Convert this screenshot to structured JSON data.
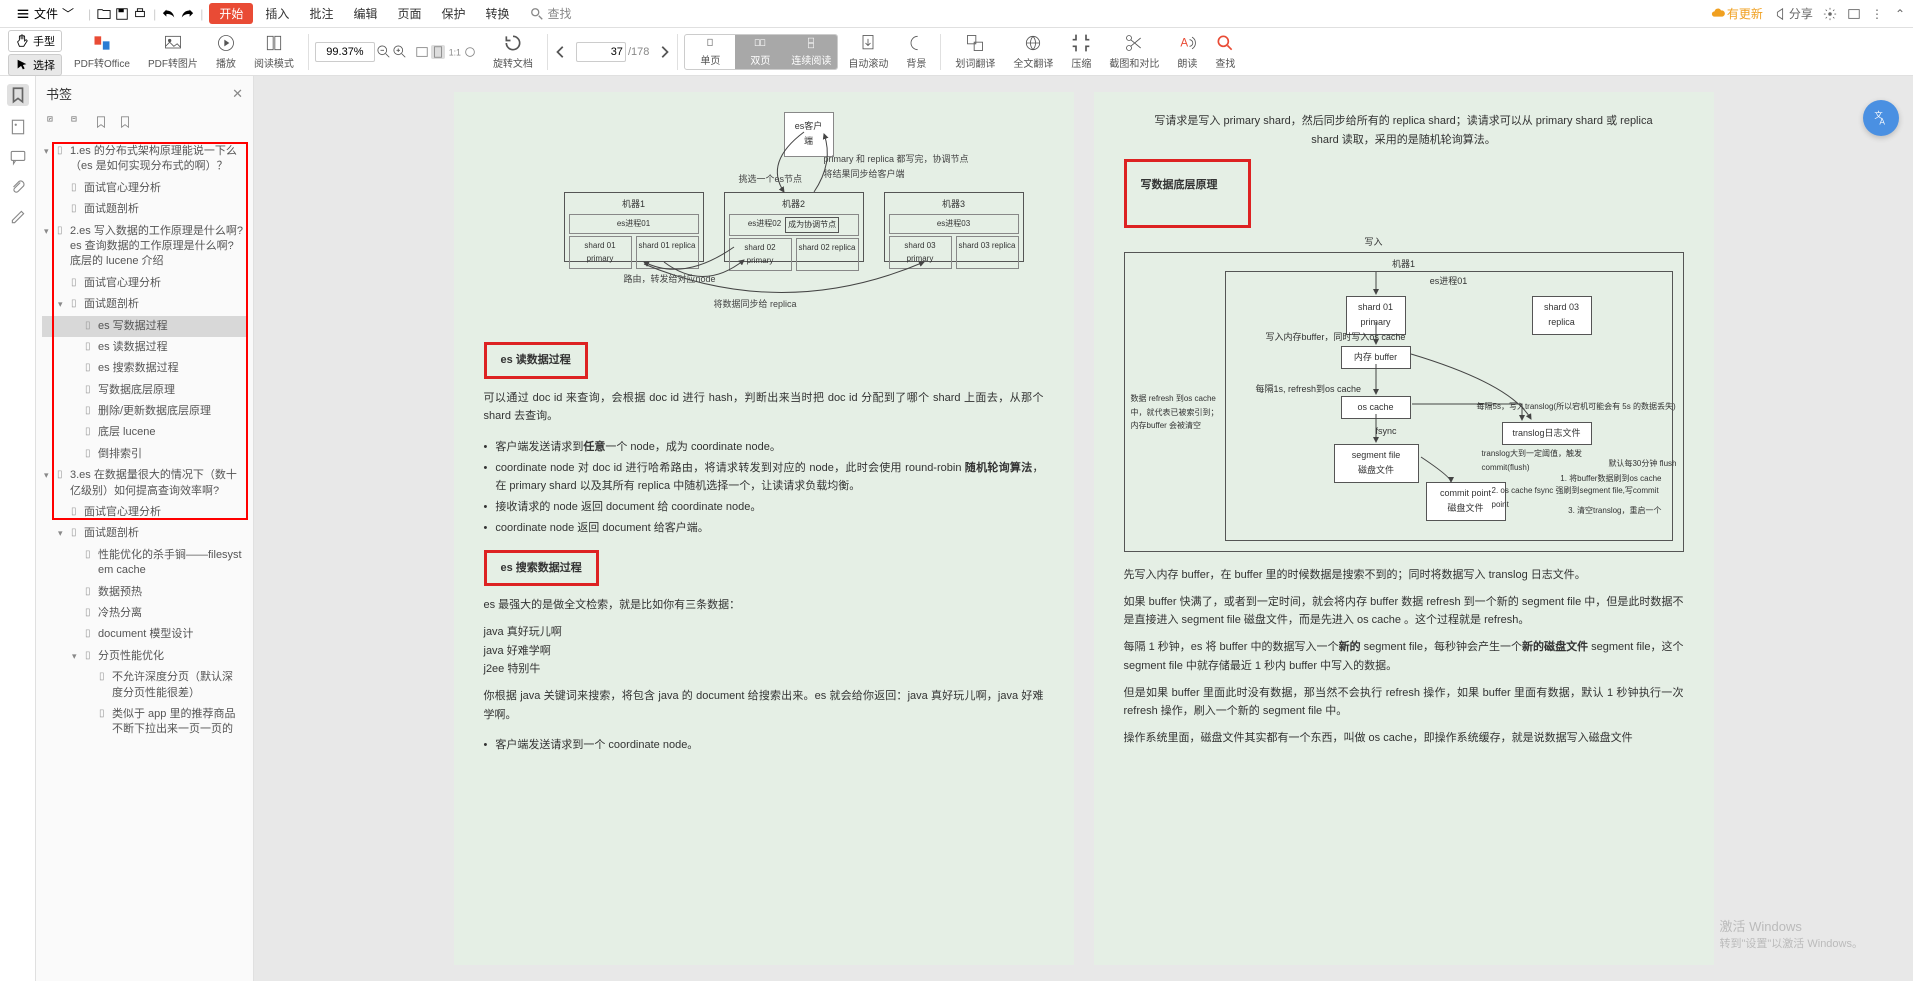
{
  "menubar": {
    "file": "文件",
    "start": "开始",
    "items": [
      "插入",
      "批注",
      "编辑",
      "页面",
      "保护",
      "转换"
    ],
    "search": "查找",
    "update": "有更新",
    "share": "分享"
  },
  "hs": {
    "hand": "手型",
    "select": "选择"
  },
  "ribbon": {
    "pdf2office": "PDF转Office",
    "pdf2img": "PDF转图片",
    "play": "播放",
    "readmode": "阅读模式",
    "zoom": "99.37%",
    "rotate": "旋转文档",
    "page_current": "37",
    "page_total": "/178",
    "single": "单页",
    "double": "双页",
    "continuous": "连续阅读",
    "autoscroll": "自动滚动",
    "bg": "背景",
    "word_trans": "划词翻译",
    "full_trans": "全文翻译",
    "compress": "压缩",
    "crop": "截图和对比",
    "read_aloud": "朗读",
    "find": "查找"
  },
  "bookmarks": {
    "title": "书签",
    "items": [
      {
        "l": 0,
        "arrow": "▾",
        "t": "1.es 的分布式架构原理能说一下么（es 是如何实现分布式的啊）？"
      },
      {
        "l": 1,
        "arrow": "",
        "t": "面试官心理分析"
      },
      {
        "l": 1,
        "arrow": "",
        "t": "面试题剖析"
      },
      {
        "l": 0,
        "arrow": "▾",
        "t": "2.es 写入数据的工作原理是什么啊?es 查询数据的工作原理是什么啊? 底层的 lucene 介绍"
      },
      {
        "l": 1,
        "arrow": "",
        "t": "面试官心理分析"
      },
      {
        "l": 1,
        "arrow": "▾",
        "t": "面试题剖析"
      },
      {
        "l": 2,
        "arrow": "",
        "t": "es 写数据过程",
        "sel": true
      },
      {
        "l": 2,
        "arrow": "",
        "t": "es 读数据过程"
      },
      {
        "l": 2,
        "arrow": "",
        "t": "es 搜索数据过程"
      },
      {
        "l": 2,
        "arrow": "",
        "t": "写数据底层原理"
      },
      {
        "l": 2,
        "arrow": "",
        "t": "删除/更新数据底层原理"
      },
      {
        "l": 2,
        "arrow": "",
        "t": "底层 lucene"
      },
      {
        "l": 2,
        "arrow": "",
        "t": "倒排索引"
      },
      {
        "l": 0,
        "arrow": "▾",
        "t": "3.es 在数据量很大的情况下（数十亿级别）如何提高查询效率啊?"
      },
      {
        "l": 1,
        "arrow": "",
        "t": "面试官心理分析"
      },
      {
        "l": 1,
        "arrow": "▾",
        "t": "面试题剖析"
      },
      {
        "l": 2,
        "arrow": "",
        "t": "性能优化的杀手锏——filesystem cache"
      },
      {
        "l": 2,
        "arrow": "",
        "t": "数据预热"
      },
      {
        "l": 2,
        "arrow": "",
        "t": "冷热分离"
      },
      {
        "l": 2,
        "arrow": "",
        "t": "document 模型设计"
      },
      {
        "l": 2,
        "arrow": "▾",
        "t": "分页性能优化"
      },
      {
        "l": 3,
        "arrow": "",
        "t": "不允许深度分页（默认深度分页性能很差）"
      },
      {
        "l": 3,
        "arrow": "",
        "t": "类似于 app 里的推荐商品不断下拉出来一页一页的"
      }
    ]
  },
  "pageL": {
    "d1": {
      "client": "es客户端",
      "note1": "primary 和 replica 都写完，协调节点将结果同步给客户端",
      "pick": "挑选一个es节点",
      "m1": "机器1",
      "m2": "机器2",
      "m3": "机器3",
      "p1": "es进程01",
      "p2": "es进程02",
      "p3": "es进程03",
      "coord": "成为协调节点",
      "s1p": "shard 01 primary",
      "s1r": "shard 01 replica",
      "s2p": "shard 02 primary",
      "s2r": "shard 02 replica",
      "s3p": "shard 03 primary",
      "s3r": "shard 03 replica",
      "route": "路由，转发给对应node",
      "sync": "将数据同步给 replica"
    },
    "h_read": "es 读数据过程",
    "p_read": "可以通过 doc id 来查询，会根据 doc id 进行 hash，判断出来当时把 doc id 分配到了哪个 shard 上面去，从那个 shard 去查询。",
    "b1a": "客户端发送请求到",
    "b1b": "任意",
    "b1c": "一个 node，成为 coordinate node。",
    "b2a": "coordinate node 对 doc id 进行哈希路由，将请求转发到对应的 node，此时会使用 round-robin",
    "b2b": "随机轮询算法",
    "b2c": "，在 primary shard 以及其所有 replica 中随机选择一个，让读请求负载均衡。",
    "b3": "接收请求的 node 返回 document 给 coordinate node。",
    "b4": "coordinate node 返回 document 给客户端。",
    "h_search": "es 搜索数据过程",
    "p_search_intro": "es 最强大的是做全文检索，就是比如你有三条数据：",
    "ex1": "java 真好玩儿啊",
    "ex2": "java 好难学啊",
    "ex3": "j2ee 特别牛",
    "p_search_res": "你根据 java 关键词来搜索，将包含 java 的 document 给搜索出来。es 就会给你返回：java 真好玩儿啊，java 好难学啊。",
    "p_search_bul": "客户端发送请求到一个 coordinate node。"
  },
  "pageR": {
    "p_top": "写请求是写入 primary shard，然后同步给所有的 replica shard；读请求可以从 primary shard 或 replica shard 读取，采用的是随机轮询算法。",
    "h_write": "写数据底层原理",
    "d2": {
      "write": "写入",
      "m": "机器1",
      "proc": "es进程01",
      "s1p": "shard 01 primary",
      "s3r": "shard 03 replica",
      "buf_note": "写入内存buffer，同时写入os cache",
      "buf": "内存 buffer",
      "refresh_l": "每隔1s, refresh到os cache",
      "refresh_note": "数据 refresh 到os cache 中，就代表已被索引到；\n内存buffer 会被清空",
      "oscache": "os cache",
      "trans_note": "每隔5s，写入translog(所以宕机可能会有 5s 的数据丢失)",
      "fsync": "fsync",
      "seg": "segment file\n磁盘文件",
      "translog": "translog日志文件",
      "commit": "commit point\n磁盘文件",
      "flush_head": "translog大到一定阈值，触发commit(flush)",
      "flush_def": "默认每30分钟 flush",
      "flush1": "1. 将buffer数据刷到os cache",
      "flush2": "2. os cache fsync 强刷到segment file,写commit point",
      "flush3": "3. 清空translog，重启一个"
    },
    "p1": "先写入内存 buffer，在 buffer 里的时候数据是搜索不到的；同时将数据写入 translog 日志文件。",
    "p2a": "如果 buffer 快满了，或者到一定时间，就会将内存 buffer 数据 refresh 到一个新的 segment file 中，但是此时数据不是直接进入 segment file 磁盘文件，而是先进入 os cache 。这个过程就是 refresh。",
    "p3a": "每隔 1 秒钟，es 将 buffer 中的数据写入一个",
    "p3b": "新的",
    "p3c": " segment file，每秒钟会产生一个",
    "p3d": "新的磁盘文件",
    "p3e": " segment file，这个 segment file 中就存储最近 1 秒内 buffer 中写入的数据。",
    "p4": "但是如果 buffer 里面此时没有数据，那当然不会执行 refresh 操作，如果 buffer 里面有数据，默认 1 秒钟执行一次 refresh 操作，刷入一个新的 segment file 中。",
    "p5": "操作系统里面，磁盘文件其实都有一个东西，叫做 os cache，即操作系统缓存，就是说数据写入磁盘文件"
  },
  "watermark": {
    "l1": "激活 Windows",
    "l2": "转到\"设置\"以激活 Windows。"
  }
}
